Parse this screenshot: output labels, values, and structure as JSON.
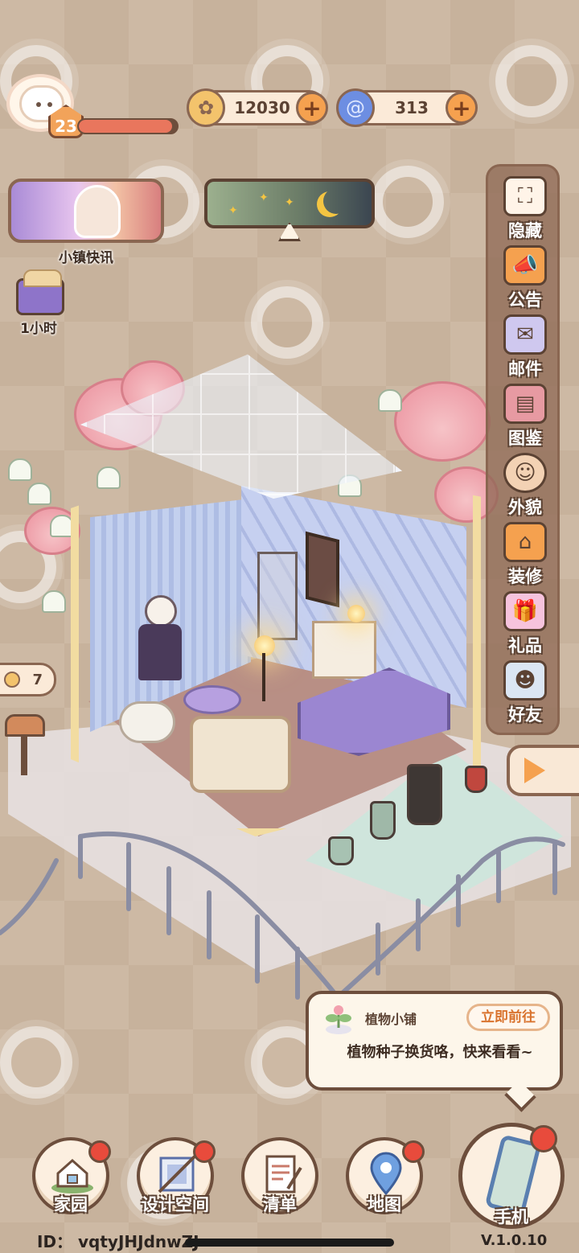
{
  "player": {
    "level": "23",
    "xp_progress": 0.95
  },
  "currency": {
    "coins": "12030",
    "gems": "313",
    "plus_label": "+"
  },
  "news": {
    "label": "小镇快讯"
  },
  "timer": {
    "label": "1小时"
  },
  "coin_badge": {
    "count": "7"
  },
  "side_menu": {
    "items": [
      {
        "label": "隐藏",
        "icon": "hide-icon"
      },
      {
        "label": "公告",
        "icon": "announcement-icon"
      },
      {
        "label": "邮件",
        "icon": "mail-icon"
      },
      {
        "label": "图鉴",
        "icon": "catalog-icon"
      },
      {
        "label": "外貌",
        "icon": "appearance-icon"
      },
      {
        "label": "装修",
        "icon": "decorate-icon"
      },
      {
        "label": "礼品",
        "icon": "gift-icon"
      },
      {
        "label": "好友",
        "icon": "friends-icon"
      }
    ]
  },
  "notice": {
    "title": "植物小铺",
    "action": "立即前往",
    "message": "植物种子换货咯，快来看看~"
  },
  "bottom_nav": {
    "items": [
      {
        "label": "家园",
        "icon": "home-icon",
        "badge": true
      },
      {
        "label": "设计空间",
        "icon": "design-icon",
        "badge": true
      },
      {
        "label": "清单",
        "icon": "list-icon",
        "badge": false
      },
      {
        "label": "地图",
        "icon": "map-icon",
        "badge": true
      }
    ],
    "phone": {
      "label": "手机",
      "icon": "phone-icon",
      "badge": true
    }
  },
  "footer": {
    "id": "ID： vqtyJHJdnwZJ",
    "version": "V.1.0.10"
  },
  "colors": {
    "accent_orange": "#f5a14f",
    "frame_brown": "#6d4e3c",
    "badge_red": "#e84b3c",
    "background": "#cdb9a4"
  }
}
